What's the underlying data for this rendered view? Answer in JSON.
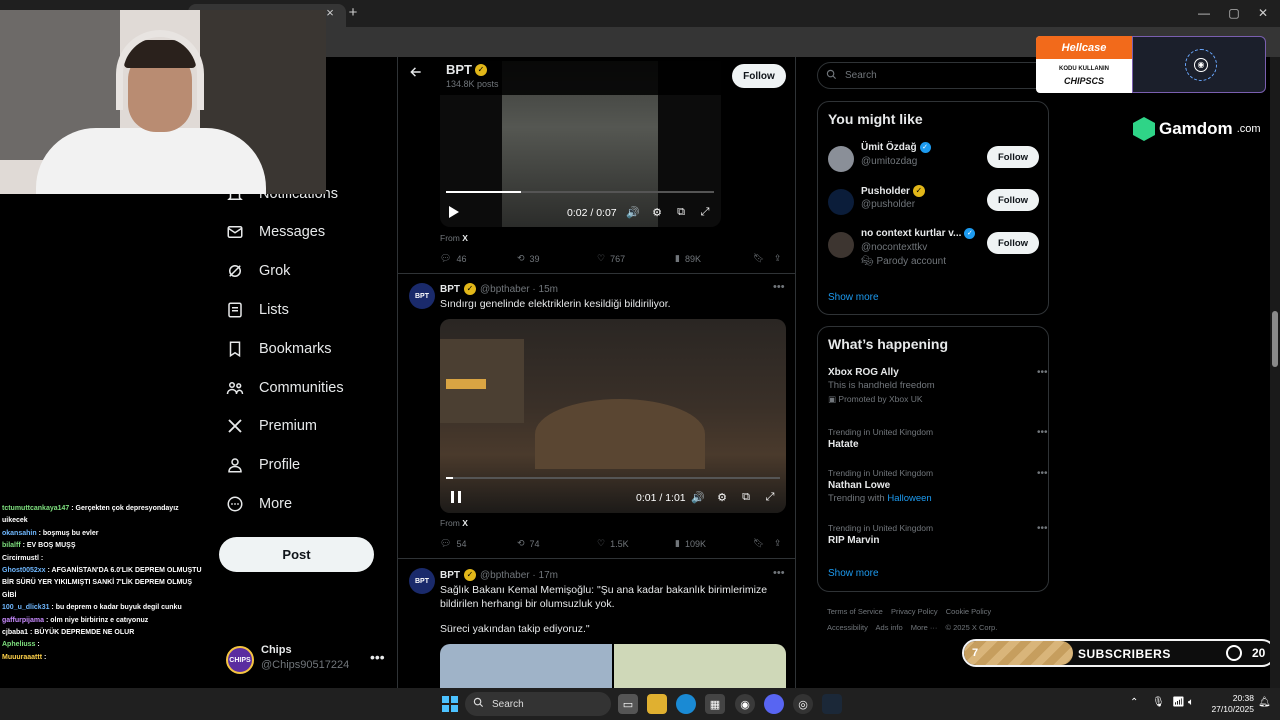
{
  "browser": {
    "tab_close": "×",
    "new_tab": "+",
    "win_min": "—",
    "win_max": "▢",
    "win_close": "✕"
  },
  "nav": {
    "items": [
      {
        "label": "Notifications",
        "icon": "bell-icon"
      },
      {
        "label": "Messages",
        "icon": "envelope-icon"
      },
      {
        "label": "Grok",
        "icon": "grok-icon"
      },
      {
        "label": "Lists",
        "icon": "list-icon"
      },
      {
        "label": "Bookmarks",
        "icon": "bookmark-icon"
      },
      {
        "label": "Communities",
        "icon": "communities-icon"
      },
      {
        "label": "Premium",
        "icon": "x-logo-icon"
      },
      {
        "label": "Profile",
        "icon": "person-icon"
      },
      {
        "label": "More",
        "icon": "more-circle-icon"
      }
    ],
    "post_label": "Post",
    "account": {
      "avatar_text": "CHIPS",
      "name": "Chips",
      "handle": "@Chips90517224",
      "more": "•••"
    }
  },
  "timeline": {
    "header": {
      "name": "BPT",
      "posts": "134.8K posts",
      "follow_label": "Follow"
    },
    "tweet1": {
      "video_time": "0:02 / 0:07",
      "progress": 0.28,
      "from_prefix": "From",
      "from_source": "X",
      "replies": "46",
      "reposts": "39",
      "likes": "767",
      "views": "89K"
    },
    "tweet2": {
      "avatar_text": "BPT",
      "name": "BPT",
      "handle": "@bpthaber · 15m",
      "text": "Sındırgı genelinde elektriklerin kesildiği bildiriliyor.",
      "video_time": "0:01 / 1:01",
      "progress": 0.02,
      "from_prefix": "From",
      "from_source": "X",
      "replies": "54",
      "reposts": "74",
      "likes": "1.5K",
      "views": "109K"
    },
    "tweet3": {
      "avatar_text": "BPT",
      "name": "BPT",
      "handle": "@bpthaber · 17m",
      "text_line1": "Sağlık Bakanı Kemal Memişoğlu: \"Şu ana kadar bakanlık birimlerimize",
      "text_line2": "bildirilen herhangi bir olumsuzluk yok.",
      "text_line3": "Süreci yakından takip ediyoruz.\""
    }
  },
  "right": {
    "search_placeholder": "Search",
    "you_might_like": {
      "title": "You might like",
      "people": [
        {
          "name": "Ümit Özdağ",
          "handle": "@umitozdag",
          "badge": "blue",
          "follow": "Follow"
        },
        {
          "name": "Pusholder",
          "handle": "@pusholder",
          "badge": "gold",
          "follow": "Follow"
        },
        {
          "name": "no context kurtlar v...",
          "handle": "@nocontexttkv",
          "badge": "blue",
          "extra": "Parody account",
          "follow": "Follow"
        }
      ],
      "show_more": "Show more"
    },
    "whats_happening": {
      "title": "What’s happening",
      "trends": [
        {
          "meta": "",
          "name": "Xbox ROG Ally",
          "sub": "This is handheld freedom",
          "promoted": "Promoted by Xbox UK"
        },
        {
          "meta": "Trending in United Kingdom",
          "name": "Hatate"
        },
        {
          "meta": "Trending in United Kingdom",
          "name": "Nathan Lowe",
          "with_prefix": "Trending with",
          "with_link": "Halloween"
        },
        {
          "meta": "Trending in United Kingdom",
          "name": "RIP Marvin"
        }
      ],
      "show_more": "Show more"
    },
    "footer": [
      "Terms of Service",
      "Privacy Policy",
      "Cookie Policy",
      "Accessibility",
      "Ads info",
      "More ···",
      "© 2025 X Corp."
    ]
  },
  "chat": [
    {
      "user": "tctumuttcankaya147",
      "color": "#7ee07e",
      "msg": "Gerçekten çok depresyondayız uikecek"
    },
    {
      "user": "okansahin",
      "color": "#6fb8ff",
      "msg": "boşmuş bu evler"
    },
    {
      "user": "bilalff",
      "color": "#7ee07e",
      "msg": "EV BOŞ MUŞŞ"
    },
    {
      "user": "Circirmustl",
      "color": "#ffffff",
      "msg": ""
    },
    {
      "user": "Ghost0052xx",
      "color": "#6fb8ff",
      "msg": "AFGANİSTAN'DA 6.0'LIK DEPREM OLMUŞTU BİR SÜRÜ YER YIKILMIŞTI SANKİ 7'LİK DEPREM OLMUŞ GİBİ"
    },
    {
      "user": "100_u_dlick31",
      "color": "#6fb8ff",
      "msg": "bu deprem o kadar buyuk degil cunku"
    },
    {
      "user": "gaffurpijama",
      "color": "#c98bff",
      "msg": "olm niye birbirinz e catıyonuz"
    },
    {
      "user": "cjbaba1",
      "color": "#ffffff",
      "msg": "BÜYÜK DEPREMDE NE OLUR"
    },
    {
      "user": "Apheliuss",
      "color": "#7ee07e",
      "msg": ""
    },
    {
      "user": "Muuuraaattt",
      "color": "#ffd24a",
      "msg": ""
    }
  ],
  "overlays": {
    "hellcase_brand": "Hellcase",
    "hellcase_line1": "KODU KULLANIN",
    "hellcase_line2": "CHIPSCS",
    "gamdom_brand": "Gamdom",
    "gamdom_suffix": ".com",
    "subs_start": "7",
    "subs_label": "SUBSCRIBERS",
    "subs_goal": "20",
    "subs_progress": 0.35
  },
  "taskbar": {
    "search_label": "Search",
    "time": "20:38",
    "date": "27/10/2025"
  }
}
